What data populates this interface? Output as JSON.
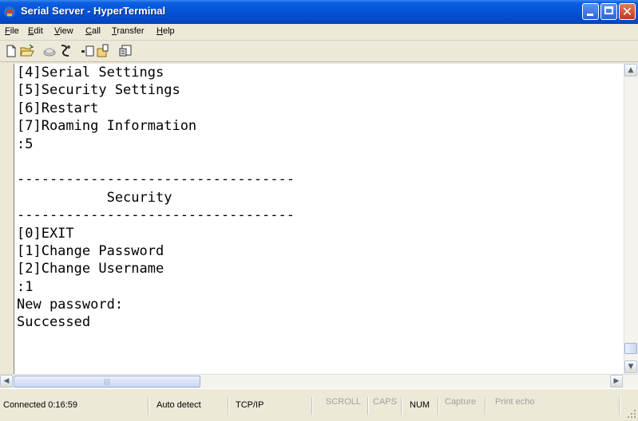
{
  "window": {
    "title": "Serial Server - HyperTerminal",
    "icon": "hyperterminal-app-icon",
    "controls": [
      "minimize-icon",
      "maximize-icon",
      "close-icon"
    ]
  },
  "menu": {
    "items": [
      {
        "label": "File",
        "accel": "F"
      },
      {
        "label": "Edit",
        "accel": "E"
      },
      {
        "label": "View",
        "accel": "V"
      },
      {
        "label": "Call",
        "accel": "C"
      },
      {
        "label": "Transfer",
        "accel": "T"
      },
      {
        "label": "Help",
        "accel": "H"
      }
    ]
  },
  "toolbar": {
    "buttons": [
      "new-document-icon",
      "open-folder-icon",
      "call-icon",
      "disconnect-icon",
      "send-icon",
      "receive-icon",
      "properties-icon"
    ]
  },
  "terminal": {
    "lines": [
      "[4]Serial Settings",
      "[5]Security Settings",
      "[6]Restart",
      "[7]Roaming Information",
      ":5",
      "",
      "----------------------------------",
      "           Security",
      "----------------------------------",
      "[0]EXIT",
      "[1]Change Password",
      "[2]Change Username",
      ":1",
      "New password:",
      "Successed"
    ]
  },
  "scrollbars": {
    "vertical_up": "scroll-up-arrow-icon",
    "vertical_down": "scroll-down-arrow-icon",
    "horizontal_left": "scroll-left-arrow-icon",
    "horizontal_right": "scroll-right-arrow-icon"
  },
  "status": {
    "connected": "Connected 0:16:59",
    "detect": "Auto detect",
    "protocol": "TCP/IP",
    "scroll": "SCROLL",
    "caps": "CAPS",
    "num": "NUM",
    "capture": "Capture",
    "print_echo": "Print echo"
  },
  "colors": {
    "titlebar": "#0552d6",
    "window_chrome": "#ece9d8",
    "terminal_bg": "#ffffff",
    "terminal_text": "#000000"
  }
}
